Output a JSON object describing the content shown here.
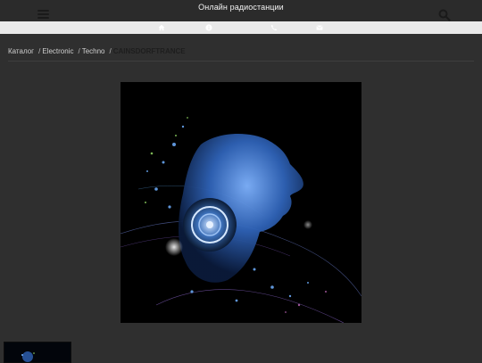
{
  "header": {
    "title": "Онлайн радиостанции",
    "menu_icon": "hamburger-menu-icon",
    "search_icon": "search-icon"
  },
  "subbar": {
    "icons": [
      "home-icon",
      "info-icon",
      "phone-icon",
      "mail-icon"
    ]
  },
  "breadcrumb": {
    "items": [
      "Каталог",
      "Electronic",
      "Techno"
    ],
    "current": "CAINSDORFTRANCE",
    "separator": "/"
  },
  "colors": {
    "page_bg": "#2f2f2f",
    "subbar_bg": "#e9e9e9",
    "cover_accent": "#3f7fd6"
  },
  "cover": {
    "description_icon": "station-cover-image"
  }
}
